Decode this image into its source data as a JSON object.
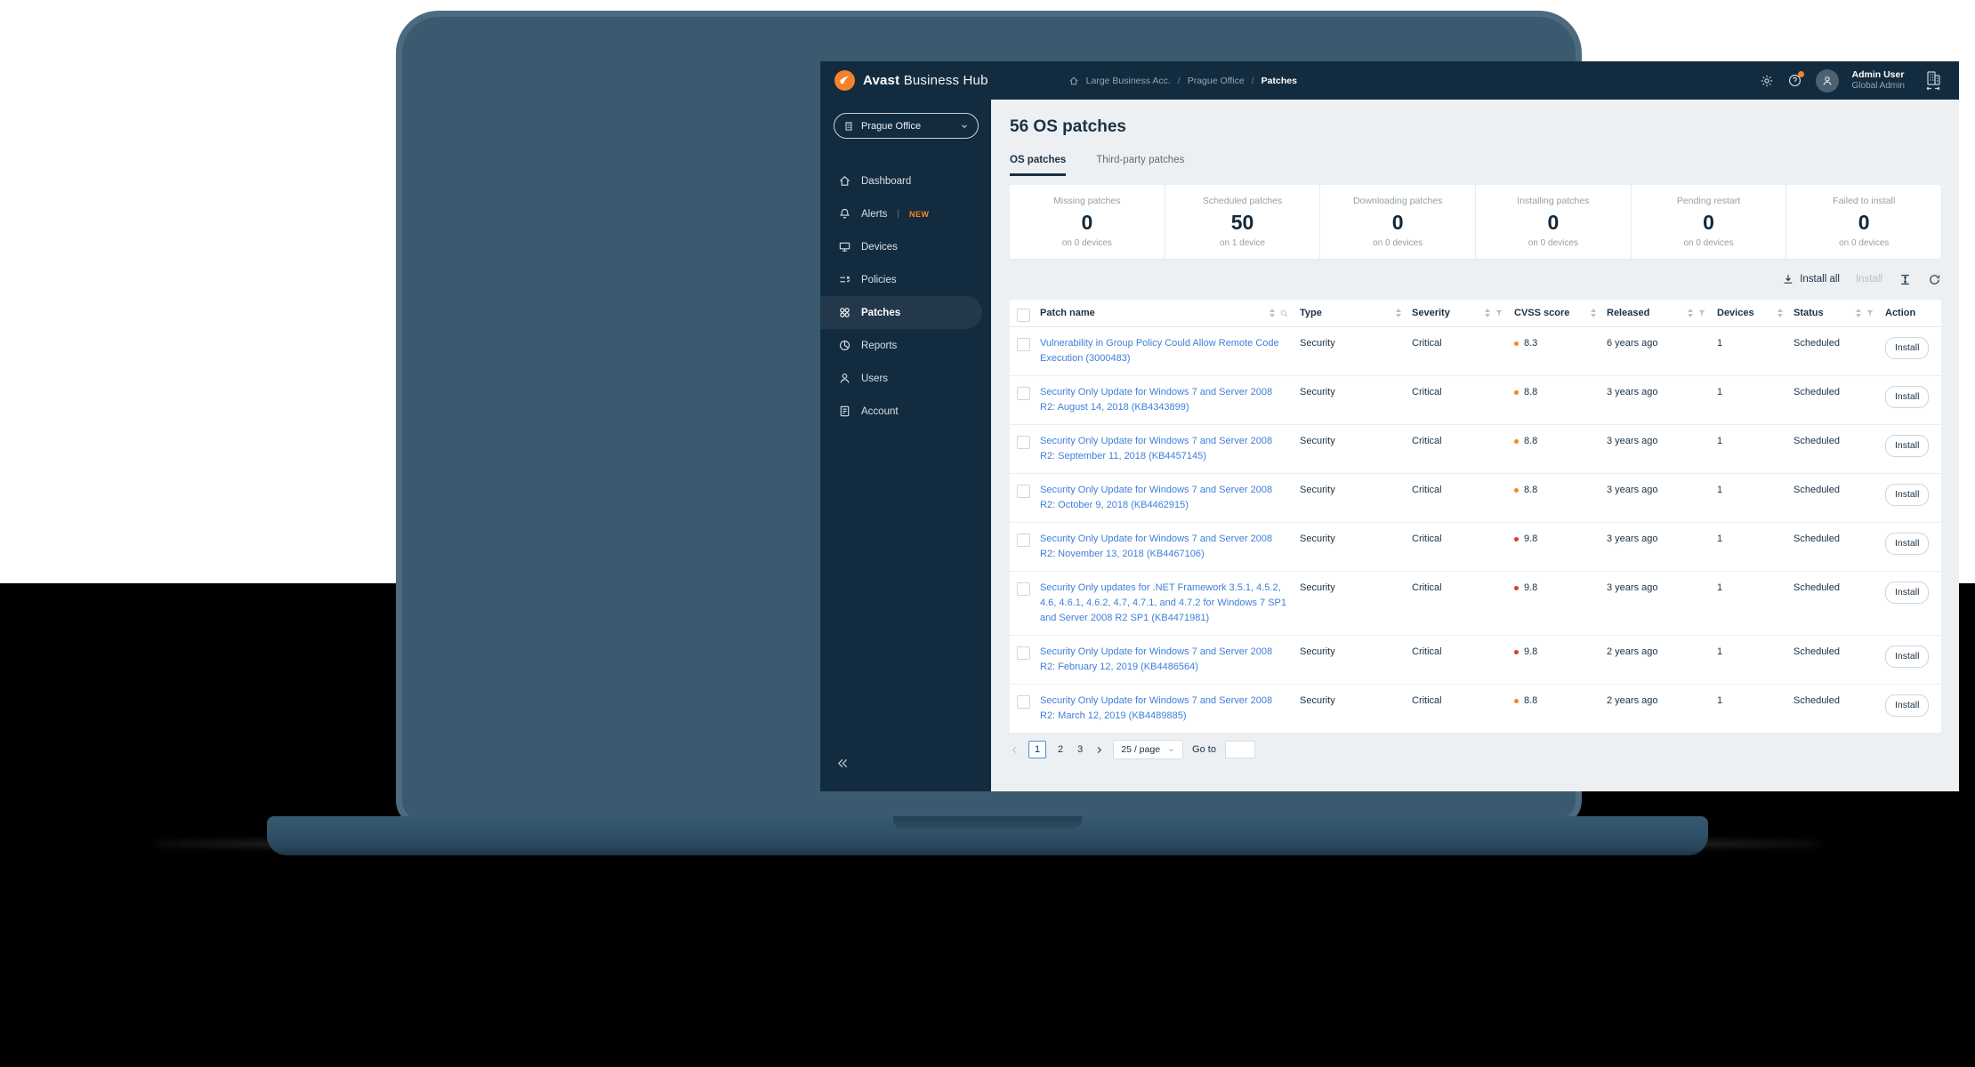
{
  "topbar": {
    "brand_bold": "Avast",
    "brand_light": "Business Hub",
    "breadcrumb": {
      "separator": "/",
      "items": [
        "Large Business Acc.",
        "Prague Office",
        "Patches"
      ]
    },
    "user": {
      "name": "Admin User",
      "role": "Global Admin"
    }
  },
  "sidebar": {
    "org_selector": {
      "label": "Prague Office"
    },
    "items": [
      {
        "label": "Dashboard"
      },
      {
        "label": "Alerts",
        "divider": "|",
        "badge": "NEW"
      },
      {
        "label": "Devices"
      },
      {
        "label": "Policies"
      },
      {
        "label": "Patches",
        "active": true
      },
      {
        "label": "Reports"
      },
      {
        "label": "Users"
      },
      {
        "label": "Account"
      }
    ]
  },
  "main": {
    "title": "56 OS patches",
    "tabs": [
      {
        "label": "OS patches",
        "active": true
      },
      {
        "label": "Third-party patches"
      }
    ],
    "stats": [
      {
        "label": "Missing patches",
        "value": "0",
        "sub": "on 0 devices"
      },
      {
        "label": "Scheduled patches",
        "value": "50",
        "sub": "on 1 device"
      },
      {
        "label": "Downloading patches",
        "value": "0",
        "sub": "on 0 devices"
      },
      {
        "label": "Installing patches",
        "value": "0",
        "sub": "on 0 devices"
      },
      {
        "label": "Pending restart",
        "value": "0",
        "sub": "on 0 devices"
      },
      {
        "label": "Failed to install",
        "value": "0",
        "sub": "on 0 devices"
      }
    ],
    "toolbar": {
      "install_all": "Install all",
      "install": "Install"
    },
    "table": {
      "columns": [
        "Patch name",
        "Type",
        "Severity",
        "CVSS score",
        "Released",
        "Devices",
        "Status",
        "Action"
      ],
      "rows": [
        {
          "name": "Vulnerability in Group Policy Could Allow Remote Code Execution (3000483)",
          "type": "Security",
          "severity": "Critical",
          "cvss": "8.3",
          "dot": "#EF8B1F",
          "released": "6 years ago",
          "devices": "1",
          "status": "Scheduled",
          "action": "Install"
        },
        {
          "name": "Security Only Update for Windows 7 and Server 2008 R2: August 14, 2018 (KB4343899)",
          "type": "Security",
          "severity": "Critical",
          "cvss": "8.8",
          "dot": "#EF8B1F",
          "released": "3 years ago",
          "devices": "1",
          "status": "Scheduled",
          "action": "Install"
        },
        {
          "name": "Security Only Update for Windows 7 and Server 2008 R2: September 11, 2018 (KB4457145)",
          "type": "Security",
          "severity": "Critical",
          "cvss": "8.8",
          "dot": "#EF8B1F",
          "released": "3 years ago",
          "devices": "1",
          "status": "Scheduled",
          "action": "Install"
        },
        {
          "name": "Security Only Update for Windows 7 and Server 2008 R2: October 9, 2018 (KB4462915)",
          "type": "Security",
          "severity": "Critical",
          "cvss": "8.8",
          "dot": "#EF8B1F",
          "released": "3 years ago",
          "devices": "1",
          "status": "Scheduled",
          "action": "Install"
        },
        {
          "name": "Security Only Update for Windows 7 and Server 2008 R2: November 13, 2018 (KB4467106)",
          "type": "Security",
          "severity": "Critical",
          "cvss": "9.8",
          "dot": "#E03A2F",
          "released": "3 years ago",
          "devices": "1",
          "status": "Scheduled",
          "action": "Install"
        },
        {
          "name": "Security Only updates for .NET Framework 3.5.1, 4.5.2, 4.6, 4.6.1, 4.6.2, 4.7, 4.7.1, and 4.7.2 for Windows 7 SP1 and Server 2008 R2 SP1 (KB4471981)",
          "type": "Security",
          "severity": "Critical",
          "cvss": "9.8",
          "dot": "#E03A2F",
          "released": "3 years ago",
          "devices": "1",
          "status": "Scheduled",
          "action": "Install"
        },
        {
          "name": "Security Only Update for Windows 7 and Server 2008 R2: February 12, 2019 (KB4486564)",
          "type": "Security",
          "severity": "Critical",
          "cvss": "9.8",
          "dot": "#E03A2F",
          "released": "2 years ago",
          "devices": "1",
          "status": "Scheduled",
          "action": "Install"
        },
        {
          "name": "Security Only Update for Windows 7 and Server 2008 R2: March 12, 2019 (KB4489885)",
          "type": "Security",
          "severity": "Critical",
          "cvss": "8.8",
          "dot": "#EF8B1F",
          "released": "2 years ago",
          "devices": "1",
          "status": "Scheduled",
          "action": "Install"
        }
      ]
    },
    "pagination": {
      "pages": [
        "1",
        "2",
        "3"
      ],
      "current": "1",
      "page_size": "25 / page",
      "goto_label": "Go to"
    }
  },
  "icons": {
    "logo": "avast-logo-icon",
    "breadcrumb_home": "home-icon",
    "settings": "gear-icon",
    "help": "help-icon with orange notification dot",
    "org_switch": "company-switcher-icon",
    "install_all": "download-icon",
    "row_height": "column-height-icon",
    "refresh": "refresh-icon"
  },
  "colors": {
    "accent_orange": "#F5822A",
    "new_badge": "#F5871F",
    "link_blue": "#3F7FD8",
    "cvss_high": "#EF8B1F",
    "cvss_critical": "#E03A2F",
    "sidebar_navy": "#132B3E",
    "page_active_border": "#4A8FDC"
  }
}
